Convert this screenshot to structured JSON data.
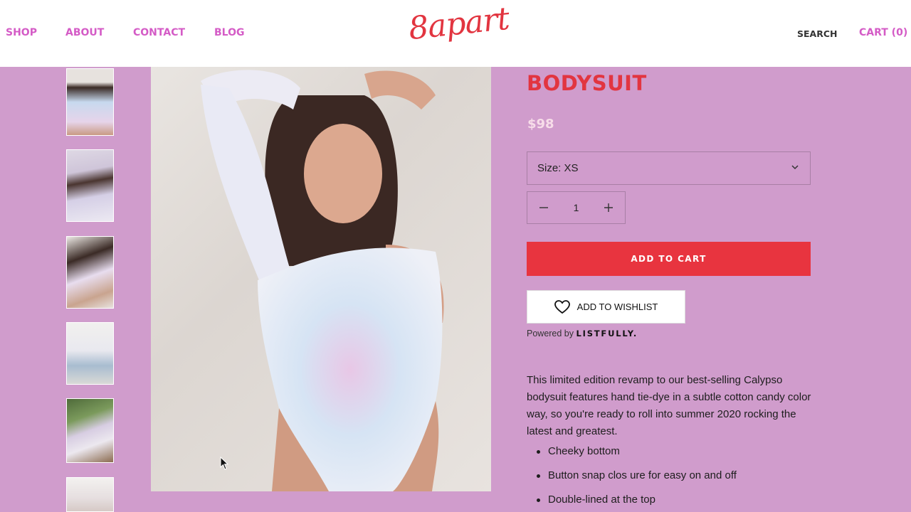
{
  "header": {
    "nav": [
      "SHOP",
      "ABOUT",
      "CONTACT",
      "BLOG"
    ],
    "logo": "8apart",
    "search_label": "SEARCH",
    "cart_label": "CART (0)"
  },
  "product": {
    "title": "BODYSUIT",
    "price": "$98",
    "size_label": "Size: XS",
    "quantity": "1",
    "add_to_cart_label": "ADD TO CART",
    "wishlist_label": "ADD TO WISHLIST",
    "powered_by_prefix": "Powered by",
    "powered_by_brand": "LISTFULLY.",
    "description": "This limited edition revamp to our best-selling Calypso bodysuit features hand tie-dye in a subtle cotton candy color way, so you're ready to roll into summer 2020 rocking the latest and greatest.",
    "features": [
      "Cheeky bottom",
      "Button snap clos ure for easy on and off",
      "Double-lined at the top"
    ]
  },
  "colors": {
    "background": "#d09ccc",
    "brand_red": "#e23540",
    "nav_pink": "#d45bc6",
    "button_red": "#e8343f"
  }
}
